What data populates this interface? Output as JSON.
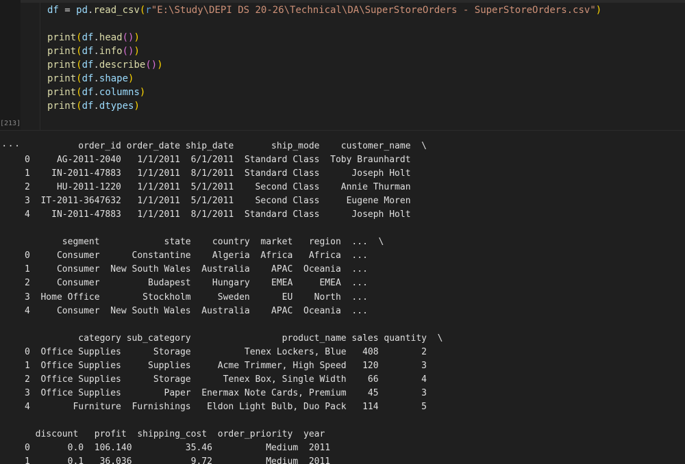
{
  "cell": {
    "execution_count": "[213]",
    "code_lines": [
      [
        {
          "t": "df",
          "c": "var"
        },
        {
          "t": " = ",
          "c": "op"
        },
        {
          "t": "pd",
          "c": "var"
        },
        {
          "t": ".",
          "c": "dot"
        },
        {
          "t": "read_csv",
          "c": "fn"
        },
        {
          "t": "(",
          "c": "p1"
        },
        {
          "t": "r",
          "c": "prefix"
        },
        {
          "t": "\"E:\\Study\\DEPI DS 20-26\\Technical\\DA\\SuperStoreOrders - SuperStoreOrders.csv\"",
          "c": "str"
        },
        {
          "t": ")",
          "c": "p1"
        }
      ],
      [],
      [
        {
          "t": "print",
          "c": "fn"
        },
        {
          "t": "(",
          "c": "p1"
        },
        {
          "t": "df",
          "c": "var"
        },
        {
          "t": ".",
          "c": "dot"
        },
        {
          "t": "head",
          "c": "fn"
        },
        {
          "t": "()",
          "c": "p2"
        },
        {
          "t": ")",
          "c": "p1"
        }
      ],
      [
        {
          "t": "print",
          "c": "fn"
        },
        {
          "t": "(",
          "c": "p1"
        },
        {
          "t": "df",
          "c": "var"
        },
        {
          "t": ".",
          "c": "dot"
        },
        {
          "t": "info",
          "c": "fn"
        },
        {
          "t": "()",
          "c": "p2"
        },
        {
          "t": ")",
          "c": "p1"
        }
      ],
      [
        {
          "t": "print",
          "c": "fn"
        },
        {
          "t": "(",
          "c": "p1"
        },
        {
          "t": "df",
          "c": "var"
        },
        {
          "t": ".",
          "c": "dot"
        },
        {
          "t": "describe",
          "c": "fn"
        },
        {
          "t": "()",
          "c": "p2"
        },
        {
          "t": ")",
          "c": "p1"
        }
      ],
      [
        {
          "t": "print",
          "c": "fn"
        },
        {
          "t": "(",
          "c": "p1"
        },
        {
          "t": "df",
          "c": "var"
        },
        {
          "t": ".",
          "c": "dot"
        },
        {
          "t": "shape",
          "c": "var"
        },
        {
          "t": ")",
          "c": "p1"
        }
      ],
      [
        {
          "t": "print",
          "c": "fn"
        },
        {
          "t": "(",
          "c": "p1"
        },
        {
          "t": "df",
          "c": "var"
        },
        {
          "t": ".",
          "c": "dot"
        },
        {
          "t": "columns",
          "c": "var"
        },
        {
          "t": ")",
          "c": "p1"
        }
      ],
      [
        {
          "t": "print",
          "c": "fn"
        },
        {
          "t": "(",
          "c": "p1"
        },
        {
          "t": "df",
          "c": "var"
        },
        {
          "t": ".",
          "c": "dot"
        },
        {
          "t": "dtypes",
          "c": "var"
        },
        {
          "t": ")",
          "c": "p1"
        }
      ]
    ]
  },
  "output": {
    "ellipsis": "...",
    "lines": [
      "          order_id order_date ship_date       ship_mode    customer_name  \\",
      "0     AG-2011-2040   1/1/2011  6/1/2011  Standard Class  Toby Braunhardt   ",
      "1    IN-2011-47883   1/1/2011  8/1/2011  Standard Class      Joseph Holt   ",
      "2     HU-2011-1220   1/1/2011  5/1/2011    Second Class    Annie Thurman   ",
      "3  IT-2011-3647632   1/1/2011  5/1/2011    Second Class     Eugene Moren   ",
      "4    IN-2011-47883   1/1/2011  8/1/2011  Standard Class      Joseph Holt   ",
      "",
      "       segment            state    country  market   region  ...  \\",
      "0     Consumer      Constantine    Algeria  Africa   Africa  ...   ",
      "1     Consumer  New South Wales  Australia    APAC  Oceania  ...   ",
      "2     Consumer         Budapest    Hungary    EMEA     EMEA  ...   ",
      "3  Home Office        Stockholm     Sweden      EU    North  ...   ",
      "4     Consumer  New South Wales  Australia    APAC  Oceania  ...   ",
      "",
      "          category sub_category                 product_name sales quantity  \\",
      "0  Office Supplies      Storage          Tenex Lockers, Blue   408        2   ",
      "1  Office Supplies     Supplies     Acme Trimmer, High Speed   120        3   ",
      "2  Office Supplies      Storage      Tenex Box, Single Width    66        4   ",
      "3  Office Supplies        Paper  Enermax Note Cards, Premium    45        3   ",
      "4        Furniture  Furnishings   Eldon Light Bulb, Duo Pack   114        5   ",
      "",
      "  discount   profit  shipping_cost  order_priority  year  ",
      "0       0.0  106.140          35.46          Medium  2011  ",
      "1       0.1   36.036           9.72          Medium  2011  "
    ]
  }
}
